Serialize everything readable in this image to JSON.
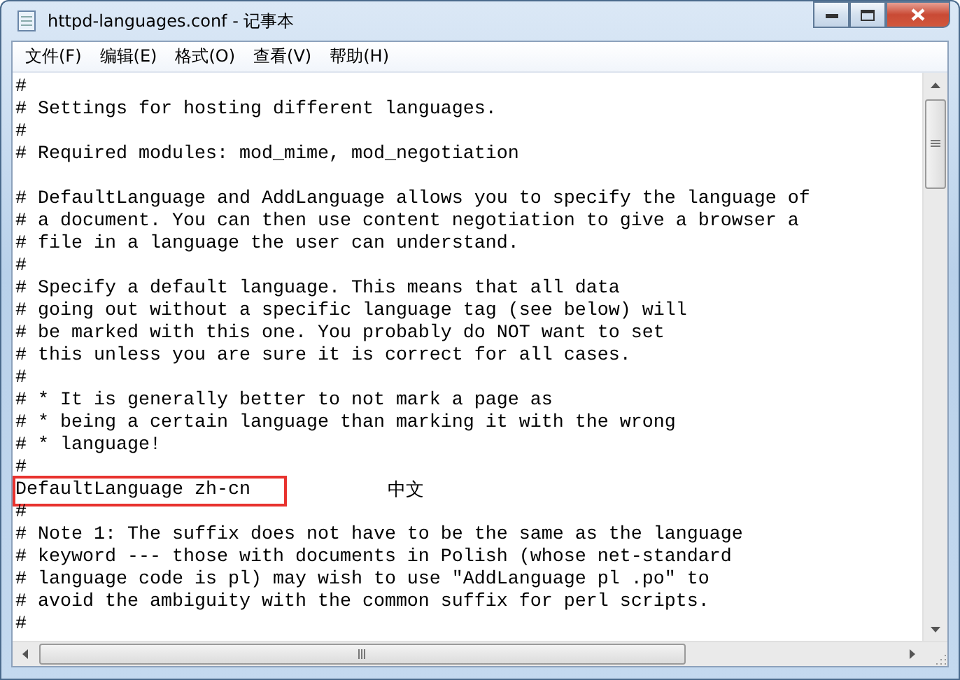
{
  "window": {
    "title": "httpd-languages.conf - 记事本"
  },
  "menu": [
    "文件(F)",
    "编辑(E)",
    "格式(O)",
    "查看(V)",
    "帮助(H)"
  ],
  "lines": [
    {
      "kind": "plain",
      "text": "#"
    },
    {
      "kind": "plain",
      "text": "# Settings for hosting different languages."
    },
    {
      "kind": "plain",
      "text": "#"
    },
    {
      "kind": "plain",
      "text": "# Required modules: mod_mime, mod_negotiation"
    },
    {
      "kind": "blank"
    },
    {
      "kind": "plain",
      "text": "# DefaultLanguage and AddLanguage allows you to specify the language of"
    },
    {
      "kind": "plain",
      "text": "# a document. You can then use content negotiation to give a browser a"
    },
    {
      "kind": "plain",
      "text": "# file in a language the user can understand."
    },
    {
      "kind": "plain",
      "text": "#"
    },
    {
      "kind": "plain",
      "text": "# Specify a default language. This means that all data"
    },
    {
      "kind": "plain",
      "text": "# going out without a specific language tag (see below) will"
    },
    {
      "kind": "plain",
      "text": "# be marked with this one. You probably do NOT want to set"
    },
    {
      "kind": "plain",
      "text": "# this unless you are sure it is correct for all cases."
    },
    {
      "kind": "plain",
      "text": "#"
    },
    {
      "kind": "plain",
      "text": "# * It is generally better to not mark a page as"
    },
    {
      "kind": "plain",
      "text": "# * being a certain language than marking it with the wrong"
    },
    {
      "kind": "plain",
      "text": "# * language!"
    },
    {
      "kind": "plain",
      "text": "#"
    },
    {
      "kind": "boxed",
      "text": "DefaultLanguage zh-cn",
      "annotation": "中文"
    },
    {
      "kind": "plain",
      "text": "#"
    },
    {
      "kind": "plain",
      "text": "# Note 1: The suffix does not have to be the same as the language"
    },
    {
      "kind": "plain",
      "text": "# keyword --- those with documents in Polish (whose net-standard"
    },
    {
      "kind": "plain",
      "text": "# language code is pl) may wish to use \"AddLanguage pl .po\" to"
    },
    {
      "kind": "plain",
      "text": "# avoid the ambiguity with the common suffix for perl scripts."
    },
    {
      "kind": "plain",
      "text": "#"
    }
  ]
}
